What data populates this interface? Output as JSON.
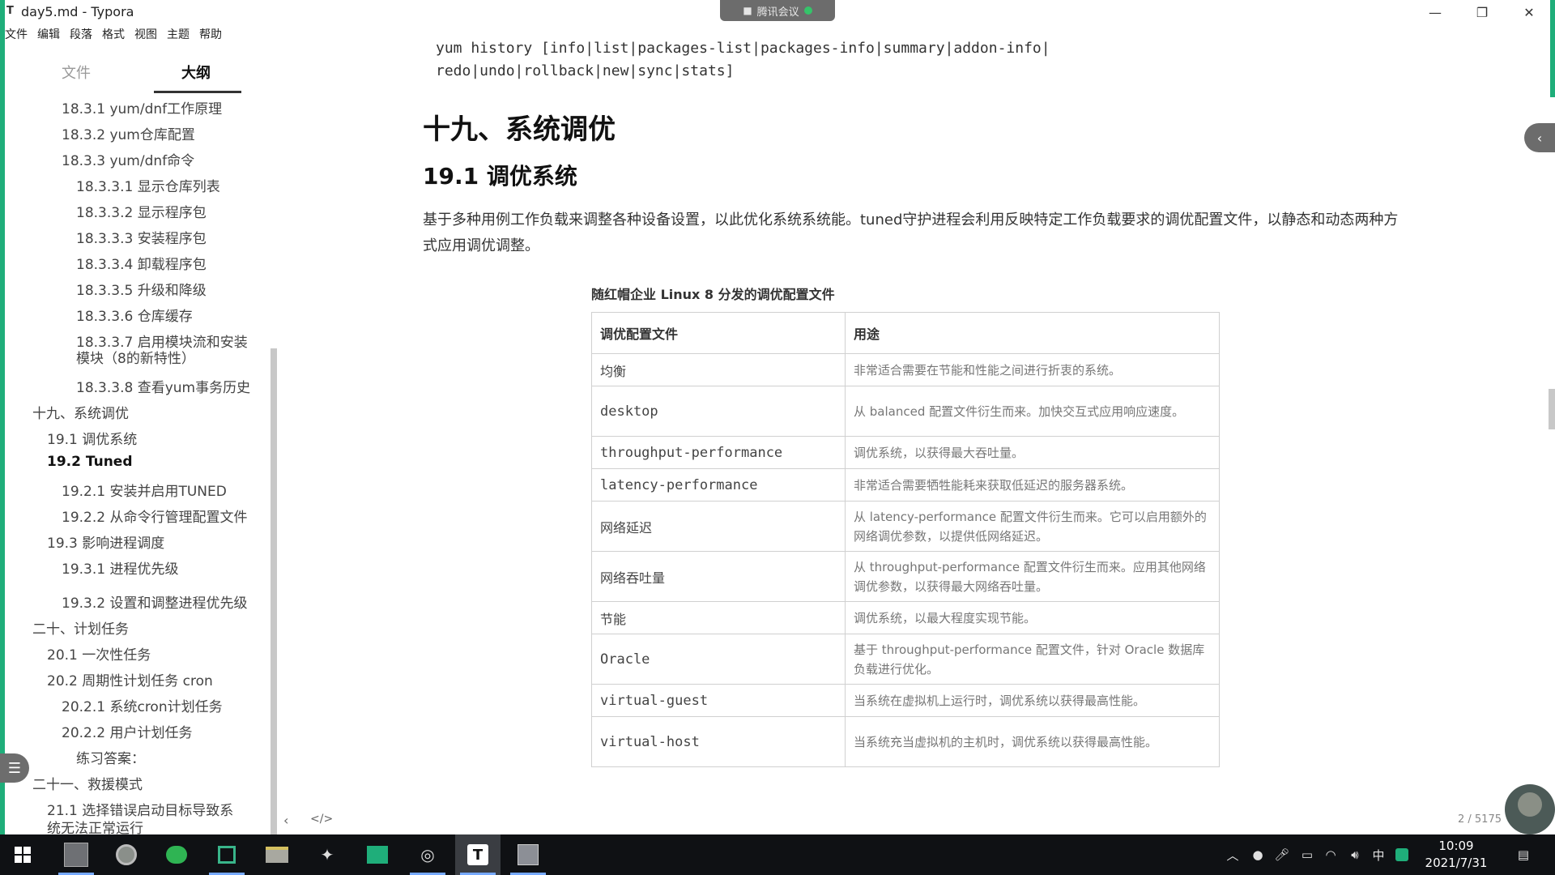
{
  "window": {
    "app_icon": "T",
    "title": "day5.md - Typora",
    "meeting_label": "腾讯会议",
    "minimize": "—",
    "restore": "❐",
    "close": "✕"
  },
  "menu": [
    "文件",
    "编辑",
    "段落",
    "格式",
    "视图",
    "主题",
    "帮助"
  ],
  "sidebar": {
    "tab_files": "文件",
    "tab_outline": "大纲",
    "items": [
      {
        "text": "18.3.1 yum/dnf工作原理",
        "indent": 2
      },
      {
        "text": "18.3.2 yum仓库配置",
        "indent": 2
      },
      {
        "text": "18.3.3 yum/dnf命令",
        "indent": 2
      },
      {
        "text": "18.3.3.1 显示仓库列表",
        "indent": 3
      },
      {
        "text": "18.3.3.2 显示程序包",
        "indent": 3
      },
      {
        "text": "18.3.3.3 安装程序包",
        "indent": 3
      },
      {
        "text": "18.3.3.4 卸载程序包",
        "indent": 3
      },
      {
        "text": "18.3.3.5 升级和降级",
        "indent": 3
      },
      {
        "text": "18.3.3.6 仓库缓存",
        "indent": 3
      },
      {
        "text": "18.3.3.7 启用模块流和安装",
        "indent": 3
      },
      {
        "text": "模块（8的新特性）",
        "indent": 3
      },
      {
        "text": "18.3.3.8 查看yum事务历史",
        "indent": 3
      },
      {
        "text": "十九、系统调优",
        "indent": 0
      },
      {
        "text": "19.1 调优系统",
        "indent": 1
      },
      {
        "text": "19.2 Tuned",
        "indent": 1,
        "bold": true
      },
      {
        "text": "19.2.1 安装并启用TUNED",
        "indent": 2
      },
      {
        "text": "19.2.2 从命令行管理配置文件",
        "indent": 2
      },
      {
        "text": "19.3 影响进程调度",
        "indent": 1
      },
      {
        "text": "19.3.1 进程优先级",
        "indent": 2
      },
      {
        "text": "19.3.2 设置和调整进程优先级",
        "indent": 2
      },
      {
        "text": "二十、计划任务",
        "indent": 0
      },
      {
        "text": "20.1 一次性任务",
        "indent": 1
      },
      {
        "text": "20.2 周期性计划任务 cron",
        "indent": 1
      },
      {
        "text": "20.2.1 系统cron计划任务",
        "indent": 2
      },
      {
        "text": "20.2.2 用户计划任务",
        "indent": 2
      },
      {
        "text": "练习答案：",
        "indent": 3
      },
      {
        "text": "二十一、救援模式",
        "indent": 0
      },
      {
        "text": "21.1 选择错误启动目标导致系",
        "indent": 1
      },
      {
        "text": "统无法正常运行",
        "indent": 1
      }
    ],
    "footer_left": "‹",
    "footer_code": "</>",
    "outline_button_icon": "list-icon"
  },
  "content": {
    "code_line1": "yum history [info|list|packages-list|packages-info|summary|addon-info|",
    "code_line2": "redo|undo|rollback|new|sync|stats]",
    "h1": "十九、系统调优",
    "h2": "19.1 调优系统",
    "paragraph": "基于多种用例工作负载来调整各种设备设置，以此优化系统系统能。tuned守护进程会利用反映特定工作负载要求的调优配置文件，以静态和动态两种方式应用调优调整。",
    "table_caption": "随红帽企业 Linux 8 分发的调优配置文件",
    "table_headers": [
      "调优配置文件",
      "用途"
    ],
    "table_rows": [
      {
        "profile": "均衡",
        "mono": false,
        "purpose": "非常适合需要在节能和性能之间进行折衷的系统。"
      },
      {
        "profile": "desktop",
        "mono": true,
        "purpose": "从 balanced 配置文件衍生而来。加快交互式应用响应速度。"
      },
      {
        "profile": "throughput-performance",
        "mono": true,
        "purpose": "调优系统，以获得最大吞吐量。"
      },
      {
        "profile": "latency-performance",
        "mono": true,
        "purpose": "非常适合需要牺牲能耗来获取低延迟的服务器系统。"
      },
      {
        "profile": "网络延迟",
        "mono": false,
        "purpose": "从 latency-performance 配置文件衍生而来。它可以启用额外的网络调优参数，以提供低网络延迟。"
      },
      {
        "profile": "网络吞吐量",
        "mono": false,
        "purpose": "从 throughput-performance 配置文件衍生而来。应用其他网络调优参数，以获得最大网络吞吐量。"
      },
      {
        "profile": "节能",
        "mono": false,
        "purpose": "调优系统，以最大程度实现节能。"
      },
      {
        "profile": "Oracle",
        "mono": true,
        "purpose": "基于 throughput-performance 配置文件，针对 Oracle 数据库负载进行优化。"
      },
      {
        "profile": "virtual-guest",
        "mono": true,
        "purpose": "当系统在虚拟机上运行时，调优系统以获得最高性能。"
      },
      {
        "profile": "virtual-host",
        "mono": true,
        "purpose": "当系统充当虚拟机的主机时，调优系统以获得最高性能。"
      }
    ],
    "page_counter": "2 / 5175"
  },
  "taskbar": {
    "start_icon": "windows-icon",
    "apps": [
      "photos",
      "chrome",
      "wechat",
      "app-green",
      "explorer",
      "app-bird",
      "app-mountain",
      "app-circle",
      "typora",
      "app-tool"
    ],
    "typora_label": "T",
    "tray_lang": "中",
    "time": "10:09",
    "date": "2021/7/31"
  }
}
